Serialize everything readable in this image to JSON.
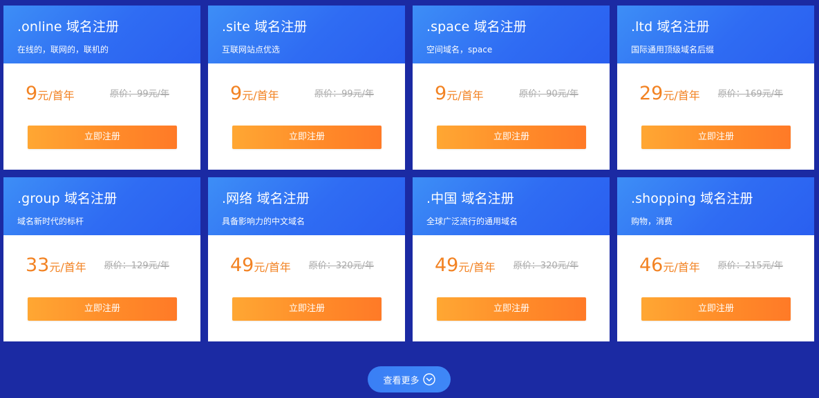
{
  "cards": [
    {
      "title": ".online 域名注册",
      "subtitle": "在线的，联网的，联机的",
      "price": "9",
      "unit": "元/首年",
      "original": "原价：99元/年",
      "button": "立即注册"
    },
    {
      "title": ".site 域名注册",
      "subtitle": "互联网站点优选",
      "price": "9",
      "unit": "元/首年",
      "original": "原价：99元/年",
      "button": "立即注册"
    },
    {
      "title": ".space 域名注册",
      "subtitle": "空间域名，space",
      "price": "9",
      "unit": "元/首年",
      "original": "原价：90元/年",
      "button": "立即注册"
    },
    {
      "title": ".ltd 域名注册",
      "subtitle": "国际通用顶级域名后缀",
      "price": "29",
      "unit": "元/首年",
      "original": "原价：169元/年",
      "button": "立即注册"
    },
    {
      "title": ".group 域名注册",
      "subtitle": "域名新时代的标杆",
      "price": "33",
      "unit": "元/首年",
      "original": "原价：129元/年",
      "button": "立即注册"
    },
    {
      "title": ".网络 域名注册",
      "subtitle": "具备影响力的中文域名",
      "price": "49",
      "unit": "元/首年",
      "original": "原价：320元/年",
      "button": "立即注册"
    },
    {
      "title": ".中国 域名注册",
      "subtitle": "全球广泛流行的通用域名",
      "price": "49",
      "unit": "元/首年",
      "original": "原价：320元/年",
      "button": "立即注册"
    },
    {
      "title": ".shopping 域名注册",
      "subtitle": "购物，消费",
      "price": "46",
      "unit": "元/首年",
      "original": "原价：215元/年",
      "button": "立即注册"
    }
  ],
  "more": {
    "label": "查看更多",
    "icon": "chevron-down-circle-icon"
  },
  "colors": {
    "background": "#1b2aa3",
    "header_gradient_start": "#3d8ef6",
    "header_gradient_end": "#2a5ff0",
    "price": "#f28222",
    "button_start": "#ffa733",
    "button_end": "#ff7a27"
  }
}
